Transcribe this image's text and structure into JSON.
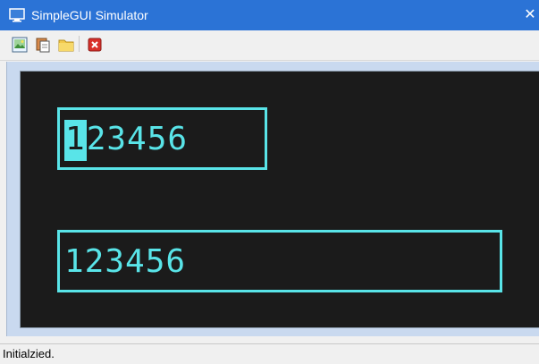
{
  "window": {
    "title": "SimpleGUI Simulator",
    "close_glyph": "✕",
    "title_bar_color": "#2b73d6"
  },
  "toolbar": {
    "buttons": [
      {
        "icon": "image-icon",
        "tooltip": ""
      },
      {
        "icon": "copy-icon",
        "tooltip": ""
      },
      {
        "icon": "folder-icon",
        "tooltip": ""
      },
      {
        "icon": "close-red-icon",
        "tooltip": ""
      }
    ]
  },
  "lcd": {
    "background": "#1b1b1b",
    "foreground": "#59e4e8",
    "textboxes": [
      {
        "value": "123456",
        "cursor_index": 0,
        "cursor_char": "1",
        "rest": "23456",
        "focused": true
      },
      {
        "value": "123456",
        "focused": false
      }
    ]
  },
  "status": {
    "text": "Initialzied."
  }
}
